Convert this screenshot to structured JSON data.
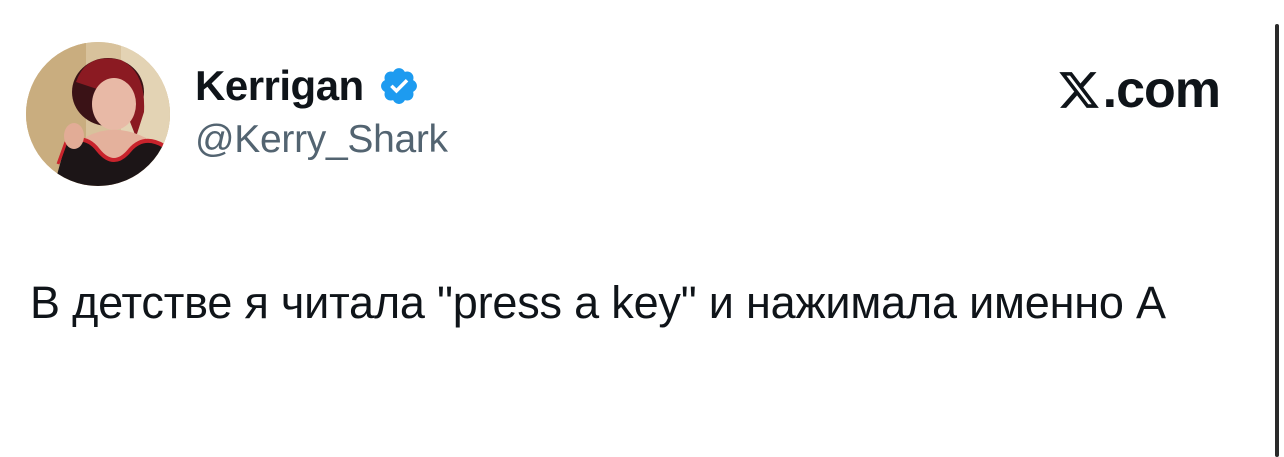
{
  "tweet": {
    "author": {
      "display_name": "Kerrigan",
      "handle": "@Kerry_Shark",
      "verified": true,
      "avatar_icon": "profile-photo"
    },
    "brand": {
      "logo_icon": "x-logo-icon",
      "label": ".com"
    },
    "text": "В детстве я читала \"press a key\" и нажимала именно А"
  },
  "colors": {
    "text_primary": "#0f1419",
    "text_secondary": "#536471",
    "verified_blue": "#1d9bf0",
    "background": "#ffffff"
  }
}
